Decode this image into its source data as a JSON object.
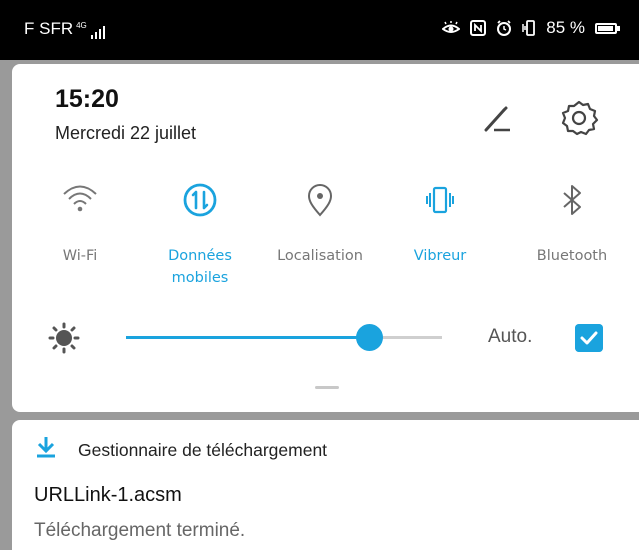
{
  "status_bar": {
    "carrier": "F SFR",
    "network": "4G",
    "battery_text": "85 %",
    "icons": [
      "eye-comfort-icon",
      "nfc-icon",
      "alarm-icon",
      "vibrate-icon",
      "battery-icon"
    ]
  },
  "header": {
    "time": "15:20",
    "date": "Mercredi 22 juillet"
  },
  "toggles": [
    {
      "label": "Wi-Fi",
      "icon": "wifi-icon",
      "active": false
    },
    {
      "label": "Données mobiles",
      "icon": "mobile-data-icon",
      "active": true
    },
    {
      "label": "Localisation",
      "icon": "location-icon",
      "active": false
    },
    {
      "label": "Vibreur",
      "icon": "vibrate-icon",
      "active": true
    },
    {
      "label": "Bluetooth",
      "icon": "bluetooth-icon",
      "active": false
    }
  ],
  "brightness": {
    "level": 0.77,
    "auto_label": "Auto.",
    "auto_checked": true
  },
  "notification": {
    "app_name": "Gestionnaire de téléchargement",
    "title": "URLLink-1.acsm",
    "body": "Téléchargement terminé."
  },
  "colors": {
    "accent": "#1aa3de",
    "inactive_icon": "#666666"
  }
}
